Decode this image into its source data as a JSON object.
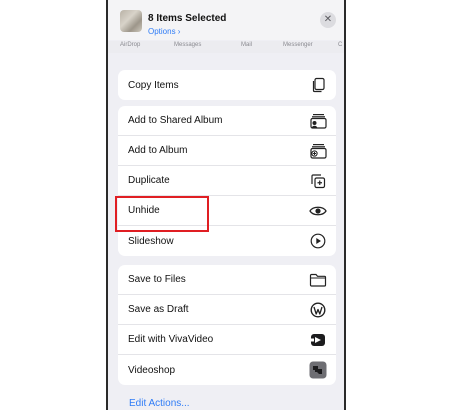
{
  "header": {
    "title": "8 Items Selected",
    "options": "Options ›",
    "close": "✕"
  },
  "share_targets": [
    "AirDrop",
    "Messages",
    "Mail",
    "Messenger",
    "C"
  ],
  "groups": [
    {
      "items": [
        {
          "label": "Copy Items",
          "icon": "copy-icon"
        }
      ]
    },
    {
      "items": [
        {
          "label": "Add to Shared Album",
          "icon": "shared-album-icon"
        },
        {
          "label": "Add to Album",
          "icon": "add-album-icon"
        },
        {
          "label": "Duplicate",
          "icon": "duplicate-icon"
        },
        {
          "label": "Unhide",
          "icon": "eye-icon"
        },
        {
          "label": "Slideshow",
          "icon": "play-circle-icon"
        }
      ]
    },
    {
      "items": [
        {
          "label": "Save to Files",
          "icon": "folder-icon"
        },
        {
          "label": "Save as Draft",
          "icon": "wordpress-icon"
        },
        {
          "label": "Edit with VivaVideo",
          "icon": "vivavideo-icon"
        },
        {
          "label": "Videoshop",
          "icon": "videoshop-icon"
        }
      ]
    }
  ],
  "edit_actions": "Edit Actions...",
  "colors": {
    "accent": "#2f7cf6",
    "highlight": "#e01e23",
    "background": "#efeff4"
  }
}
